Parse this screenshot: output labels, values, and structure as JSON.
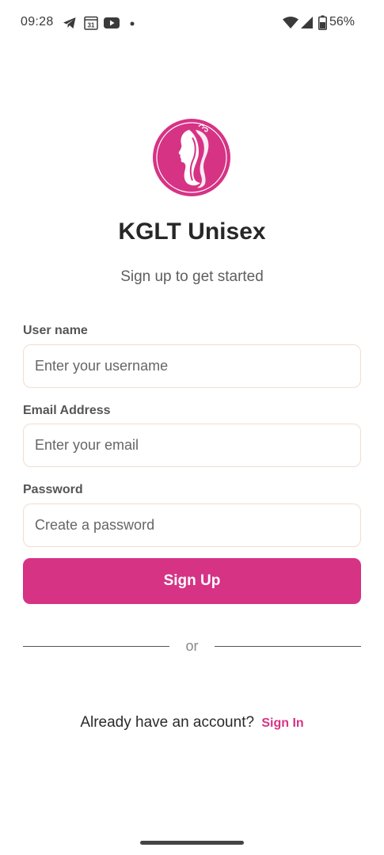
{
  "status_bar": {
    "time": "09:28",
    "calendar_day": "31",
    "battery": "56%",
    "icons": [
      "telegram-icon",
      "calendar-icon",
      "youtube-icon",
      "notification-dot-icon",
      "wifi-icon",
      "signal-icon",
      "battery-icon"
    ]
  },
  "brand": {
    "title": "KGLT Unisex",
    "subtitle": "Sign up to get started",
    "accent_color": "#d63385"
  },
  "form": {
    "username": {
      "label": "User name",
      "placeholder": "Enter your username",
      "value": ""
    },
    "email": {
      "label": "Email Address",
      "placeholder": "Enter your email",
      "value": ""
    },
    "password": {
      "label": "Password",
      "placeholder": "Create a password",
      "value": ""
    },
    "submit_label": "Sign Up"
  },
  "divider": {
    "text": "or"
  },
  "footer": {
    "prompt": "Already have an account?",
    "link_label": "Sign In"
  }
}
